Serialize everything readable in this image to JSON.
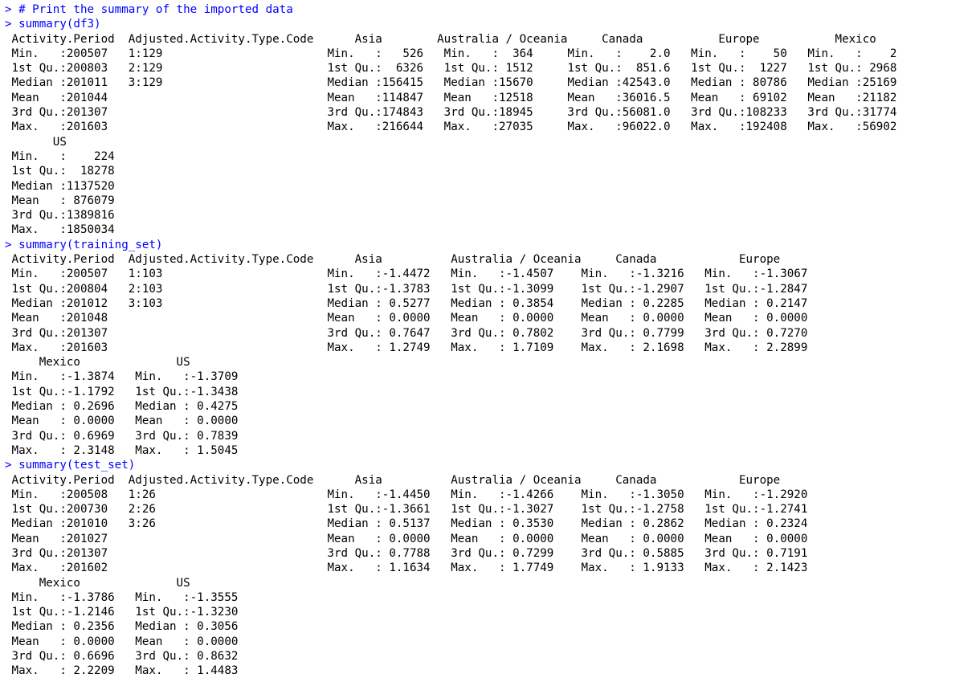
{
  "console": {
    "lines": [
      {
        "kind": "input",
        "prompt": ">",
        "text": " # Print the summary of the imported data"
      },
      {
        "kind": "input",
        "prompt": ">",
        "text": " summary(df3)"
      },
      {
        "kind": "output",
        "text": " Activity.Period  Adjusted.Activity.Type.Code      Asia        Australia / Oceania     Canada           Europe           Mexico"
      },
      {
        "kind": "output",
        "text": " Min.   :200507   1:129                        Min.   :   526   Min.   :  364     Min.   :    2.0   Min.   :    50   Min.   :    2"
      },
      {
        "kind": "output",
        "text": " 1st Qu.:200803   2:129                        1st Qu.:  6326   1st Qu.: 1512     1st Qu.:  851.6   1st Qu.:  1227   1st Qu.: 2968"
      },
      {
        "kind": "output",
        "text": " Median :201011   3:129                        Median :156415   Median :15670     Median :42543.0   Median : 80786   Median :25169"
      },
      {
        "kind": "output",
        "text": " Mean   :201044                                Mean   :114847   Mean   :12518     Mean   :36016.5   Mean   : 69102   Mean   :21182"
      },
      {
        "kind": "output",
        "text": " 3rd Qu.:201307                                3rd Qu.:174843   3rd Qu.:18945     3rd Qu.:56081.0   3rd Qu.:108233   3rd Qu.:31774"
      },
      {
        "kind": "output",
        "text": " Max.   :201603                                Max.   :216644   Max.   :27035     Max.   :96022.0   Max.   :192408   Max.   :56902"
      },
      {
        "kind": "output",
        "text": "       US"
      },
      {
        "kind": "output",
        "text": " Min.   :    224"
      },
      {
        "kind": "output",
        "text": " 1st Qu.:  18278"
      },
      {
        "kind": "output",
        "text": " Median :1137520"
      },
      {
        "kind": "output",
        "text": " Mean   : 876079"
      },
      {
        "kind": "output",
        "text": " 3rd Qu.:1389816"
      },
      {
        "kind": "output",
        "text": " Max.   :1850034"
      },
      {
        "kind": "input",
        "prompt": ">",
        "text": " summary(training_set)"
      },
      {
        "kind": "output",
        "text": " Activity.Period  Adjusted.Activity.Type.Code      Asia          Australia / Oceania     Canada            Europe"
      },
      {
        "kind": "output",
        "text": " Min.   :200507   1:103                        Min.   :-1.4472   Min.   :-1.4507    Min.   :-1.3216   Min.   :-1.3067"
      },
      {
        "kind": "output",
        "text": " 1st Qu.:200804   2:103                        1st Qu.:-1.3783   1st Qu.:-1.3099    1st Qu.:-1.2907   1st Qu.:-1.2847"
      },
      {
        "kind": "output",
        "text": " Median :201012   3:103                        Median : 0.5277   Median : 0.3854    Median : 0.2285   Median : 0.2147"
      },
      {
        "kind": "output",
        "text": " Mean   :201048                                Mean   : 0.0000   Mean   : 0.0000    Mean   : 0.0000   Mean   : 0.0000"
      },
      {
        "kind": "output",
        "text": " 3rd Qu.:201307                                3rd Qu.: 0.7647   3rd Qu.: 0.7802    3rd Qu.: 0.7799   3rd Qu.: 0.7270"
      },
      {
        "kind": "output",
        "text": " Max.   :201603                                Max.   : 1.2749   Max.   : 1.7109    Max.   : 2.1698   Max.   : 2.2899"
      },
      {
        "kind": "output",
        "text": "     Mexico              US"
      },
      {
        "kind": "output",
        "text": " Min.   :-1.3874   Min.   :-1.3709"
      },
      {
        "kind": "output",
        "text": " 1st Qu.:-1.1792   1st Qu.:-1.3438"
      },
      {
        "kind": "output",
        "text": " Median : 0.2696   Median : 0.4275"
      },
      {
        "kind": "output",
        "text": " Mean   : 0.0000   Mean   : 0.0000"
      },
      {
        "kind": "output",
        "text": " 3rd Qu.: 0.6969   3rd Qu.: 0.7839"
      },
      {
        "kind": "output",
        "text": " Max.   : 2.3148   Max.   : 1.5045"
      },
      {
        "kind": "input",
        "prompt": ">",
        "text": " summary(test_set)"
      },
      {
        "kind": "output",
        "text": " Activity.Period  Adjusted.Activity.Type.Code      Asia          Australia / Oceania     Canada            Europe"
      },
      {
        "kind": "output",
        "text": " Min.   :200508   1:26                         Min.   :-1.4450   Min.   :-1.4266    Min.   :-1.3050   Min.   :-1.2920"
      },
      {
        "kind": "output",
        "text": " 1st Qu.:200730   2:26                         1st Qu.:-1.3661   1st Qu.:-1.3027    1st Qu.:-1.2758   1st Qu.:-1.2741"
      },
      {
        "kind": "output",
        "text": " Median :201010   3:26                         Median : 0.5137   Median : 0.3530    Median : 0.2862   Median : 0.2324"
      },
      {
        "kind": "output",
        "text": " Mean   :201027                                Mean   : 0.0000   Mean   : 0.0000    Mean   : 0.0000   Mean   : 0.0000"
      },
      {
        "kind": "output",
        "text": " 3rd Qu.:201307                                3rd Qu.: 0.7788   3rd Qu.: 0.7299    3rd Qu.: 0.5885   3rd Qu.: 0.7191"
      },
      {
        "kind": "output",
        "text": " Max.   :201602                                Max.   : 1.1634   Max.   : 1.7749    Max.   : 1.9133   Max.   : 2.1423"
      },
      {
        "kind": "output",
        "text": "     Mexico              US"
      },
      {
        "kind": "output",
        "text": " Min.   :-1.3786   Min.   :-1.3555"
      },
      {
        "kind": "output",
        "text": " 1st Qu.:-1.2146   1st Qu.:-1.3230"
      },
      {
        "kind": "output",
        "text": " Median : 0.2356   Median : 0.3056"
      },
      {
        "kind": "output",
        "text": " Mean   : 0.0000   Mean   : 0.0000"
      },
      {
        "kind": "output",
        "text": " 3rd Qu.: 0.6696   3rd Qu.: 0.8632"
      },
      {
        "kind": "output",
        "text": " Max.   : 2.2209   Max.   : 1.4483"
      }
    ]
  },
  "colors": {
    "prompt": "#0000ff",
    "command": "#0000ff",
    "output": "#000000",
    "background": "#ffffff"
  }
}
